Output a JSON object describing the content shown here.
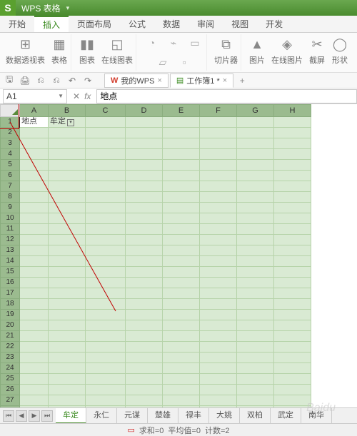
{
  "app": {
    "icon_letter": "S",
    "name": "WPS 表格",
    "dropdown": "▾"
  },
  "menu": {
    "items": [
      "开始",
      "插入",
      "页面布局",
      "公式",
      "数据",
      "审阅",
      "视图",
      "开发"
    ],
    "active_index": 1
  },
  "ribbon": {
    "groups": [
      {
        "items": [
          {
            "icon": "⊞",
            "label": "数据透视表"
          },
          {
            "icon": "▦",
            "label": "表格"
          }
        ]
      },
      {
        "items": [
          {
            "icon": "▮▮",
            "label": "图表"
          },
          {
            "icon": "◱",
            "label": "在线图表"
          }
        ],
        "small": [
          "◔",
          "⌁",
          "▭",
          "▱",
          "▫"
        ]
      },
      {
        "items": [
          {
            "icon": "⧉",
            "label": "切片器"
          }
        ]
      },
      {
        "items": [
          {
            "icon": "▲",
            "label": "图片"
          },
          {
            "icon": "◈",
            "label": "在线图片"
          },
          {
            "icon": "✂",
            "label": "截屏"
          },
          {
            "icon": "◯",
            "label": "形状"
          }
        ]
      }
    ]
  },
  "qat": {
    "buttons": [
      "🖫",
      "🖨",
      "⎌",
      "⎌",
      "↶",
      "↷"
    ]
  },
  "doc_tabs": {
    "my_wps": "我的WPS",
    "workbook": "工作簿1 *",
    "add": "+"
  },
  "formula_bar": {
    "name_box": "A1",
    "fx": "fx",
    "value": "地点",
    "cancel": "✕",
    "accept": "✓"
  },
  "columns": [
    "A",
    "B",
    "C",
    "D",
    "E",
    "F",
    "G",
    "H"
  ],
  "rows_count": 29,
  "cells": {
    "A1": "地点",
    "B1": "牟定"
  },
  "filter_label": "▾",
  "sheet_nav": [
    "⏮",
    "◀",
    "▶",
    "⏭"
  ],
  "sheets": {
    "items": [
      "牟定",
      "永仁",
      "元谋",
      "楚雄",
      "禄丰",
      "大姚",
      "双柏",
      "武定",
      "南华"
    ],
    "active_index": 0
  },
  "status": {
    "sum_label": "求和=0",
    "avg_label": "平均值=0",
    "count_label": "计数=2"
  },
  "watermark": "Baidu"
}
